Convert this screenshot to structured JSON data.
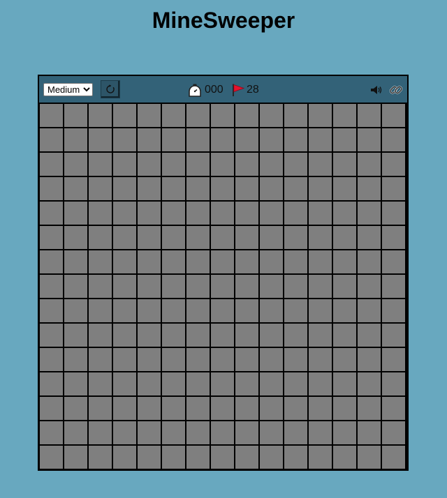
{
  "title": "MineSweeper",
  "toolbar": {
    "difficulty_selected": "Medium",
    "timer_value": "000",
    "flags_value": "28",
    "icons": {
      "reset": "refresh-icon",
      "timer": "stopwatch-icon",
      "flag": "red-flag-icon",
      "sound": "speaker-icon",
      "link": "link-icon"
    }
  },
  "board": {
    "rows": 15,
    "columns": 15,
    "cell_state": "unrevealed"
  },
  "colors": {
    "page_background": "#68a8bf",
    "toolbar_background": "#336278",
    "cell_unrevealed": "#7f7f7f",
    "grid_lines": "#000000",
    "flag": "#e8112d"
  }
}
